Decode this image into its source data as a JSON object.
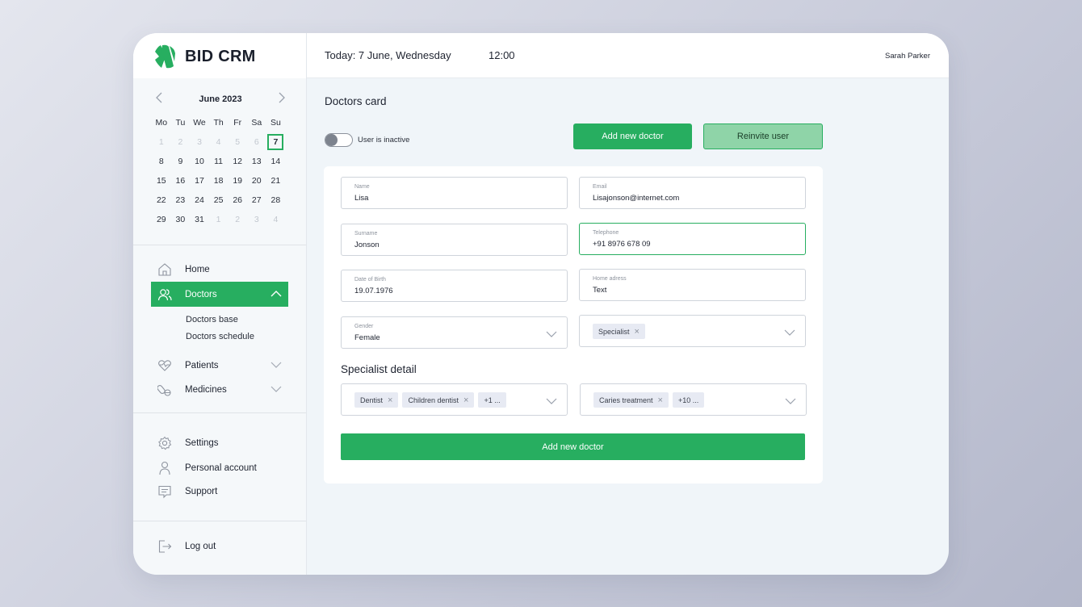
{
  "app": {
    "logo_text": "BID CRM",
    "brand_color": "#27ae60"
  },
  "topbar": {
    "today": "Today: 7 June, Wednesday",
    "time": "12:00",
    "user": "Sarah Parker"
  },
  "calendar": {
    "title": "June 2023",
    "prev_icon": "chevron-left-icon",
    "next_icon": "chevron-right-icon",
    "weekdays": [
      "Mo",
      "Tu",
      "We",
      "Th",
      "Fr",
      "Sa",
      "Su"
    ],
    "days": [
      {
        "d": "1",
        "m": true
      },
      {
        "d": "2",
        "m": true
      },
      {
        "d": "3",
        "m": true
      },
      {
        "d": "4",
        "m": true
      },
      {
        "d": "5",
        "m": true
      },
      {
        "d": "6",
        "m": true
      },
      {
        "d": "7",
        "t": true
      },
      {
        "d": "8"
      },
      {
        "d": "9"
      },
      {
        "d": "10"
      },
      {
        "d": "11"
      },
      {
        "d": "12"
      },
      {
        "d": "13"
      },
      {
        "d": "14"
      },
      {
        "d": "15"
      },
      {
        "d": "16"
      },
      {
        "d": "17"
      },
      {
        "d": "18"
      },
      {
        "d": "19"
      },
      {
        "d": "20"
      },
      {
        "d": "21"
      },
      {
        "d": "22"
      },
      {
        "d": "23"
      },
      {
        "d": "24"
      },
      {
        "d": "25"
      },
      {
        "d": "26"
      },
      {
        "d": "27"
      },
      {
        "d": "28"
      },
      {
        "d": "29"
      },
      {
        "d": "30"
      },
      {
        "d": "31"
      },
      {
        "d": "1",
        "m": true
      },
      {
        "d": "2",
        "m": true
      },
      {
        "d": "3",
        "m": true
      },
      {
        "d": "4",
        "m": true
      }
    ]
  },
  "sidebar": {
    "home": "Home",
    "doctors": "Doctors",
    "doctors_base": "Doctors base",
    "doctors_schedule": "Doctors schedule",
    "patients": "Patients",
    "medicines": "Medicines",
    "settings": "Settings",
    "personal_account": "Personal account",
    "support": "Support",
    "logout": "Log out"
  },
  "main": {
    "title": "Doctors card",
    "toggle_label": "User is inactive",
    "toggle_on": false,
    "add_doctor_btn": "Add new doctor",
    "reinvite_btn": "Reinvite user",
    "fields": {
      "name": {
        "label": "Name",
        "value": "Lisa"
      },
      "email": {
        "label": "Email",
        "value": "Lisajonson@internet.com"
      },
      "surname": {
        "label": "Surname",
        "value": "Jonson"
      },
      "telephone": {
        "label": "Telephone",
        "value": "+91 8976 678 09"
      },
      "dob": {
        "label": "Date of Birth",
        "value": "19.07.1976"
      },
      "address": {
        "label": "Home adress",
        "value": "Text"
      },
      "gender": {
        "label": "Gender",
        "value": "Female"
      }
    },
    "role_chips": [
      "Specialist"
    ],
    "section_title": "Specialist detail",
    "specialty_chips": [
      "Dentist",
      "Children dentist"
    ],
    "specialty_more": "+1 ...",
    "treatment_chips": [
      "Caries treatment"
    ],
    "treatment_more": "+10 ...",
    "submit_btn": "Add new doctor"
  }
}
